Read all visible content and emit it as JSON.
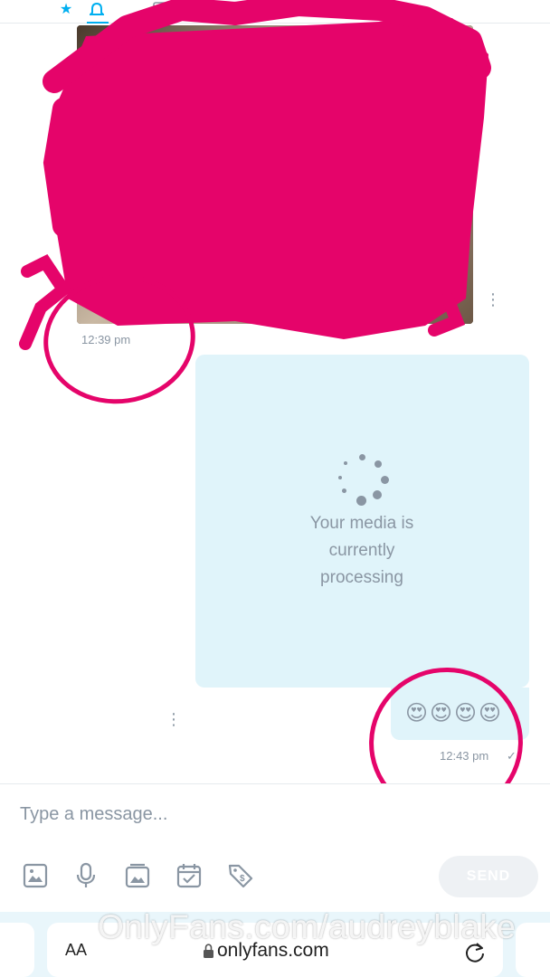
{
  "chat": {
    "received_time": "12:39 pm",
    "processing_text_lines": [
      "Your media is",
      "currently",
      "processing"
    ],
    "emoji_message": "😍😍😍😍",
    "sent_time": "12:43 pm",
    "read_check": "✓"
  },
  "composer": {
    "placeholder": "Type a message...",
    "send_label": "SEND"
  },
  "browser": {
    "aa_label": "AA",
    "url": "onlyfans.com"
  },
  "watermark": "OnlyFans.com/audreyblake",
  "colors": {
    "accent": "#00aff0",
    "bubble": "#e0f4fa",
    "redaction": "#e5046a",
    "muted": "#8a96a3"
  }
}
